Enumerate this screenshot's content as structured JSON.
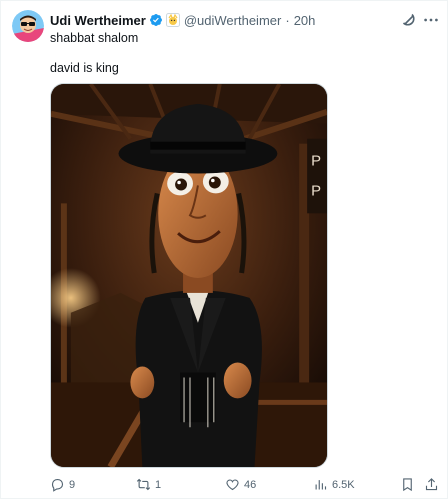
{
  "author": {
    "display_name": "Udi Wertheimer",
    "handle": "@udiWertheimer",
    "separator": "·",
    "time": "20h"
  },
  "tweet": {
    "line1": "shabbat shalom",
    "line2": "david is king"
  },
  "media": {
    "sign_letters": [
      "P",
      "P"
    ]
  },
  "actions": {
    "replies": "9",
    "reposts": "1",
    "likes": "46",
    "views": "6.5K"
  },
  "colors": {
    "verified": "#1d9bf0",
    "text": "#0f1419",
    "muted": "#536471"
  }
}
